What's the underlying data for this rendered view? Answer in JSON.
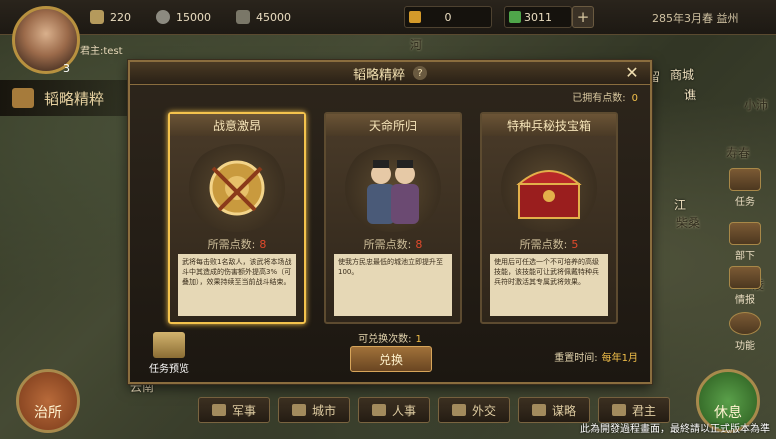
{
  "topbar": {
    "res1": "220",
    "res2": "15000",
    "res3": "45000",
    "gold": "0",
    "jade": "3011",
    "plus": "+",
    "date": "285年3月春  益州"
  },
  "player": {
    "name": "君主:test",
    "level": "3"
  },
  "left_title": "韬略精粹",
  "map_labels": {
    "river": "河",
    "liu": "留",
    "shangcheng": "商城",
    "jin": "谯",
    "xiaopei": "小沛",
    "shouchun": "寿春",
    "chaisang": "柴桑",
    "jiang": "江",
    "yunnan": "云南"
  },
  "side": {
    "task": "任务",
    "bu": "部下",
    "intel": "情报",
    "func": "功能",
    "ling": "陵"
  },
  "dialog": {
    "title": "韬略精粹",
    "help": "?",
    "close": "✕",
    "owned_label": "已拥有点数:",
    "owned_value": "0",
    "cards": [
      {
        "title": "战意激昂",
        "cost_label": "所需点数:",
        "cost_value": "8",
        "desc": "武将每击败1名敌人，该武将本场战斗中其造成的伤害额外提高3%（可叠加），效果持续至当前战斗结束。"
      },
      {
        "title": "天命所归",
        "cost_label": "所需点数:",
        "cost_value": "8",
        "desc": "使我方民忠最低的城池立即提升至100。"
      },
      {
        "title": "特种兵秘技宝箱",
        "cost_label": "所需点数:",
        "cost_value": "5",
        "desc": "使用后可任选一个不可培养的高级技能，该技能可让武将佩戴特种兵兵符时激活其专属武将效果。"
      }
    ],
    "exchange_label": "可兑换次数:",
    "exchange_value": "1",
    "exchange_button": "兑换",
    "reset_label": "重置时间:",
    "reset_value": "每年1月",
    "task_preview": "任务预览"
  },
  "bottom": {
    "zhisuo": "治所",
    "military": "军事",
    "city": "城市",
    "personnel": "人事",
    "diplomacy": "外交",
    "strategy": "谋略",
    "lord": "君主",
    "rest": "休息",
    "notice": "此為開發過程畫面，最終請以正式版本為準"
  },
  "colors": {
    "accent_gold": "#f3c04a",
    "cost_red": "#e24a2c",
    "selected_border": "#f4c34d"
  }
}
